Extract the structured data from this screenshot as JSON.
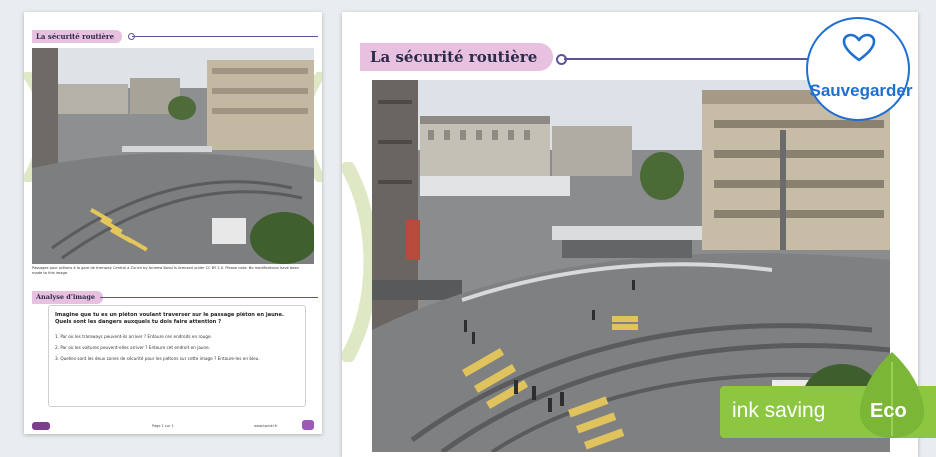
{
  "thumbnail": {
    "title": "La sécurité routière",
    "caption": "Passages pour piétons à la gare de tramway Central à Zurich by Andrew Bossi is licensed under CC BY 2.0. Please note: No modifications have been made to this image.",
    "section_title": "Analyse d'image",
    "question": "Imagine que tu es un piéton voulant traverser sur le passage piéton en jaune. Quels sont les dangers auxquels tu dois faire attention ?",
    "tasks": [
      "1.  Par où les tramways peuvent-ils arriver ? Entoure ces endroits en rouge.",
      "2.  Par où les voitures peuvent-elles arriver ? Entoure cet endroit en jaune.",
      "3.  Quelles sont les deux zones de sécurité pour les piétons sur cette image ? Entoure-les en bleu."
    ],
    "footer_center": "Page 1 sur 1",
    "footer_right": "www.twinkl.fr"
  },
  "main_page": {
    "title": "La sécurité routière"
  },
  "save_button": {
    "label": "Sauvegarder",
    "icon": "heart-outline-icon",
    "color": "#1f6fd1"
  },
  "eco_badge": {
    "text": "ink saving",
    "leaf_label": "Eco",
    "color": "#8dc641"
  },
  "colors": {
    "header_pill": "#e9c1e0",
    "header_line": "#5d5496",
    "swirl": "#dfe8c4"
  }
}
